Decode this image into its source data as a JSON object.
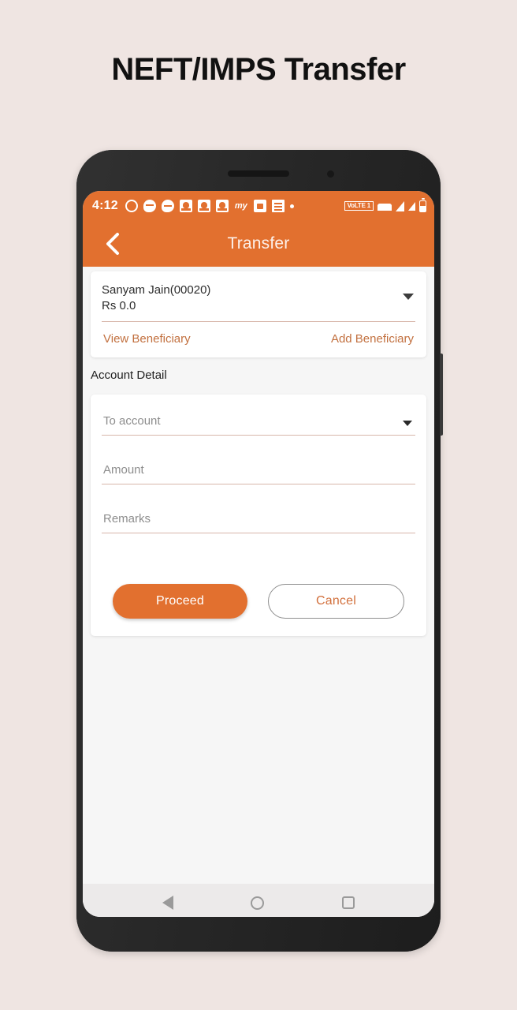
{
  "page": {
    "title": "NEFT/IMPS Transfer",
    "background_color": "#efe5e2"
  },
  "theme": {
    "accent": "#e2702f",
    "link": "#c2703f",
    "underline": "#d8b6aa",
    "screen_bg": "#f6f6f6",
    "nav_bg": "#eceaea"
  },
  "statusbar": {
    "clock": "4:12",
    "volte": "VoLTE 1",
    "notification_icons": [
      "whatsapp-icon",
      "message-bubble-icon",
      "chat-bubble-icon",
      "app-notification-icon-1",
      "app-notification-icon-2",
      "app-notification-icon-3",
      "my-app-icon",
      "camera-app-icon",
      "document-app-icon",
      "more-notifications-dot"
    ],
    "my_app_glyph": "my",
    "right_icons": [
      "wifi-icon",
      "signal-bars-icon-1",
      "signal-bars-icon-2",
      "battery-icon"
    ]
  },
  "appbar": {
    "back_icon": "chevron-left-icon",
    "title": "Transfer"
  },
  "account_selector": {
    "name": "Sanyam Jain(00020)",
    "balance": "Rs 0.0",
    "dropdown_icon": "chevron-down-icon",
    "view_beneficiary_label": "View Beneficiary",
    "add_beneficiary_label": "Add Beneficiary"
  },
  "account_detail": {
    "section_label": "Account Detail",
    "fields": [
      {
        "name": "to-account",
        "placeholder": "To account",
        "value": "",
        "type": "select"
      },
      {
        "name": "amount",
        "placeholder": "Amount",
        "value": "",
        "type": "text"
      },
      {
        "name": "remarks",
        "placeholder": "Remarks",
        "value": "",
        "type": "text"
      }
    ],
    "proceed_label": "Proceed",
    "cancel_label": "Cancel"
  },
  "navbar": {
    "back_icon": "triangle-back-icon",
    "home_icon": "circle-home-icon",
    "recents_icon": "square-recents-icon"
  }
}
